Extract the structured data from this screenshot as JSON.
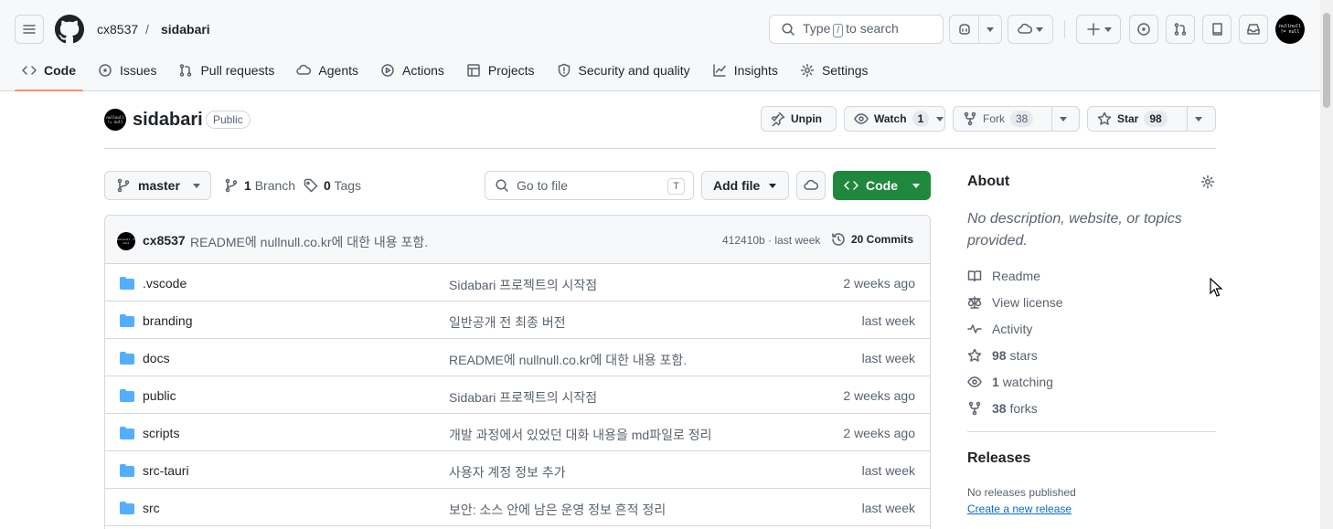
{
  "header": {
    "owner": "cx8537",
    "separator": "/",
    "repo": "sidabari",
    "search": {
      "prefix": "Type",
      "key": "/",
      "suffix": "to search"
    },
    "avatar_text": "nullnull != null"
  },
  "tabs": [
    {
      "label": "Code",
      "icon": "code-icon",
      "active": true
    },
    {
      "label": "Issues",
      "icon": "issue-icon"
    },
    {
      "label": "Pull requests",
      "icon": "pull-request-icon"
    },
    {
      "label": "Agents",
      "icon": "agents-icon"
    },
    {
      "label": "Actions",
      "icon": "play-icon"
    },
    {
      "label": "Projects",
      "icon": "table-icon"
    },
    {
      "label": "Security and quality",
      "icon": "shield-icon"
    },
    {
      "label": "Insights",
      "icon": "graph-icon"
    },
    {
      "label": "Settings",
      "icon": "gear-icon"
    }
  ],
  "repo_header": {
    "name": "sidabari",
    "visibility": "Public",
    "unpin_label": "Unpin",
    "watch_label": "Watch",
    "watch_count": "1",
    "fork_label": "Fork",
    "fork_count": "38",
    "star_label": "Star",
    "star_count": "98"
  },
  "toolbar": {
    "branch": "master",
    "branches_count": "1",
    "branches_label": "Branch",
    "tags_count": "0",
    "tags_label": "Tags",
    "goto_placeholder": "Go to file",
    "goto_key": "T",
    "add_file_label": "Add file",
    "code_label": "Code"
  },
  "latest_commit": {
    "author": "cx8537",
    "message": "README에 nullnull.co.kr에 대한 내용 포함.",
    "meta": "412410b · last week",
    "commits_label": "20 Commits"
  },
  "files": [
    {
      "name": ".vscode",
      "message": "Sidabari 프로젝트의 시작점",
      "time": "2 weeks ago"
    },
    {
      "name": "branding",
      "message": "일반공개 전 최종 버전",
      "time": "last week"
    },
    {
      "name": "docs",
      "message": "README에 nullnull.co.kr에 대한 내용 포함.",
      "time": "last week"
    },
    {
      "name": "public",
      "message": "Sidabari 프로젝트의 시작점",
      "time": "2 weeks ago"
    },
    {
      "name": "scripts",
      "message": "개발 과정에서 있었던 대화 내용을 md파일로 정리",
      "time": "2 weeks ago"
    },
    {
      "name": "src-tauri",
      "message": "사용자 계정 정보 추가",
      "time": "last week"
    },
    {
      "name": "src",
      "message": "보안: 소스 안에 남은 운영 정보 흔적 정리",
      "time": "last week"
    }
  ],
  "about": {
    "title": "About",
    "description": "No description, website, or topics provided.",
    "readme": "Readme",
    "license": "View license",
    "activity": "Activity",
    "stars_count": "98",
    "stars_label": "stars",
    "watching_count": "1",
    "watching_label": "watching",
    "forks_count": "38",
    "forks_label": "forks"
  },
  "releases": {
    "title": "Releases",
    "empty_text": "No releases published",
    "create_link": "Create a new release"
  },
  "colors": {
    "primary_button": "#1f883d",
    "active_tab_underline": "#fd8c73",
    "folder": "#54aeff",
    "link": "#0969da"
  }
}
